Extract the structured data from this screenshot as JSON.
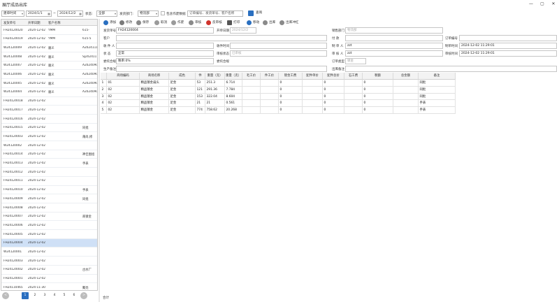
{
  "window": {
    "title": "展厅成品出库",
    "controls": [
      "—",
      "▢",
      "✕"
    ]
  },
  "filter": {
    "time_type": "建单时间",
    "date_from": "2024/1/1",
    "date_sep": "~",
    "date_to": "2024/12/2",
    "status_label": "状态:",
    "status_value": "全部",
    "dept_label": "发货部门:",
    "dept_value": "全部",
    "dept2_value": "物流部",
    "include_ops_label": "包含作废数据",
    "search_placeholder": "订单编号、发货单号、客户名称",
    "query_label": "查询"
  },
  "left_table": {
    "headers": [
      "发货单号",
      "开单日期",
      "客户名称"
    ],
    "rows": [
      [
        "FH24120020",
        "2024-12-02",
        "YMM",
        "615-"
      ],
      [
        "FH24120019",
        "2024-12-02",
        "YMM",
        "615-5"
      ],
      [
        "W24120009",
        "2024-12-02",
        "顺义",
        "A2024111"
      ],
      [
        "W24120008",
        "2024-12-02",
        "顺义",
        "SJ202411"
      ],
      [
        "W24120007",
        "2024-12-02",
        "顺义",
        "A2024090"
      ],
      [
        "W24120006",
        "2024-12-02",
        "顺义",
        "A2024090"
      ],
      [
        "W24120005",
        "2024-12-02",
        "顺义",
        "A2024090"
      ],
      [
        "W24120004",
        "2024-12-02",
        "顺义",
        "A2024090"
      ],
      [
        "FH24120018",
        "2024-12-02",
        "",
        ""
      ],
      [
        "FH24120017",
        "2024-12-02",
        "",
        ""
      ],
      [
        "FH24120016",
        "2024-12-02",
        "",
        ""
      ],
      [
        "FH24120015",
        "2024-12-02",
        "",
        "同批"
      ],
      [
        "FH24120003",
        "2024-12-02",
        "",
        "莆尚,修"
      ],
      [
        "W24120002",
        "2024-12-02",
        "",
        ""
      ],
      [
        "FH24120014",
        "2024-12-02",
        "",
        "神佳图组"
      ],
      [
        "FH24120013",
        "2024-12-02",
        "",
        "手表"
      ],
      [
        "FH24120012",
        "2024-12-02",
        "",
        ""
      ],
      [
        "FH24120011",
        "2024-12-02",
        "",
        ""
      ],
      [
        "FH24120010",
        "2024-12-02",
        "",
        "手表"
      ],
      [
        "FH24120009",
        "2024-12-02",
        "",
        "同批"
      ],
      [
        "FH24120008",
        "2024-12-02",
        "",
        ""
      ],
      [
        "FH24120007",
        "2024-12-02",
        "",
        "商镀金"
      ],
      [
        "FH24120006",
        "2024-12-02",
        "",
        ""
      ],
      [
        "FH24120005",
        "2024-12-02",
        "",
        ""
      ],
      [
        "FH24120004",
        "2024-12-02",
        "",
        ""
      ],
      [
        "W24120001",
        "2024-12-02",
        "",
        ""
      ],
      [
        "FH24120003",
        "2024-12-02",
        "",
        ""
      ],
      [
        "FH24120002",
        "2024-12-02",
        "",
        "古水厂"
      ],
      [
        "FH24120001",
        "2024-12-02",
        "",
        ""
      ],
      [
        "FH24110465",
        "2024-11-30",
        "",
        "聚亮"
      ]
    ],
    "selected_index": 24
  },
  "pager": {
    "prev": "<",
    "pages": [
      "1",
      "2",
      "3",
      "4",
      "5",
      "6"
    ],
    "current": "1",
    "next": ">"
  },
  "toolbar": {
    "items": [
      "添加",
      "修改",
      "保存",
      "取消",
      "作废",
      "审核",
      "反审核",
      "打印",
      "移动",
      "出库",
      "出库冲红"
    ]
  },
  "form": {
    "ship_no_label": "发货单号",
    "ship_no": "FH24120004",
    "open_date_label": "开单日期",
    "open_date": "2024/12/2",
    "sales_dept_label": "销售部门",
    "sales_dept": "物流部",
    "customer_label": "客户",
    "payer_label": "付   款",
    "order_no_label": "订单编号",
    "receiver_label": "收 件 人",
    "receive_time_label": "收件时间",
    "maker_label": "制 单 人",
    "maker": "zzt",
    "make_time_label": "制单时间",
    "make_time": "2024-12-02 11:29:01",
    "status_label": "状   态",
    "status": "正常",
    "audit_status_label": "审核状态",
    "audit_status": "已审核",
    "auditor_label": "审 核 人",
    "auditor": "zzt",
    "audit_time_label": "审核时间",
    "audit_time": "2024-12-02 11:29:01",
    "contract_label": "委托合规",
    "contract": "税率:0%",
    "other_contract_label": "委托合规",
    "order_type_label": "订单类型",
    "order_type": "镀金",
    "remark_label": "生产备注",
    "remark2_label": "出库备注"
  },
  "grid": {
    "headers": [
      "",
      "商场编码",
      "商场名称",
      "成色",
      "件",
      "重量（克）",
      "重量（克）",
      "毛工价",
      "件工价",
      "镀金工费",
      "配件单价",
      "配件总价",
      "石工费",
      "税额",
      "总金额",
      "备注"
    ],
    "rows": [
      [
        "1",
        "01",
        "精品镀金扁头",
        "足金",
        "53",
        "251.3",
        "6.714",
        "",
        "",
        "0",
        "",
        "0",
        "",
        "0",
        "",
        "同批"
      ],
      [
        "2",
        "02",
        "精品镀金",
        "足金",
        "121",
        "291.36",
        "7.784",
        "",
        "",
        "0",
        "",
        "0",
        "",
        "0",
        "",
        "同批"
      ],
      [
        "3",
        "02",
        "精品镀金",
        "足金",
        "153",
        "322.04",
        "8.604",
        "",
        "",
        "0",
        "",
        "0",
        "",
        "0",
        "",
        "同批"
      ],
      [
        "4",
        "02",
        "精品镀金",
        "足金",
        "21",
        "21",
        "0.561",
        "",
        "",
        "0",
        "",
        "0",
        "",
        "0",
        "",
        "手表"
      ],
      [
        "5",
        "02",
        "精品镀金",
        "足金",
        "774",
        "758.62",
        "20.268",
        "",
        "",
        "0",
        "",
        "0",
        "",
        "0",
        "",
        "手表"
      ]
    ]
  },
  "footer": {
    "total_label": "合计"
  },
  "colors": {
    "accent": "#2a6fc0",
    "selected_row": "#cfe0f6",
    "header_bg": "#f3f3f3"
  }
}
